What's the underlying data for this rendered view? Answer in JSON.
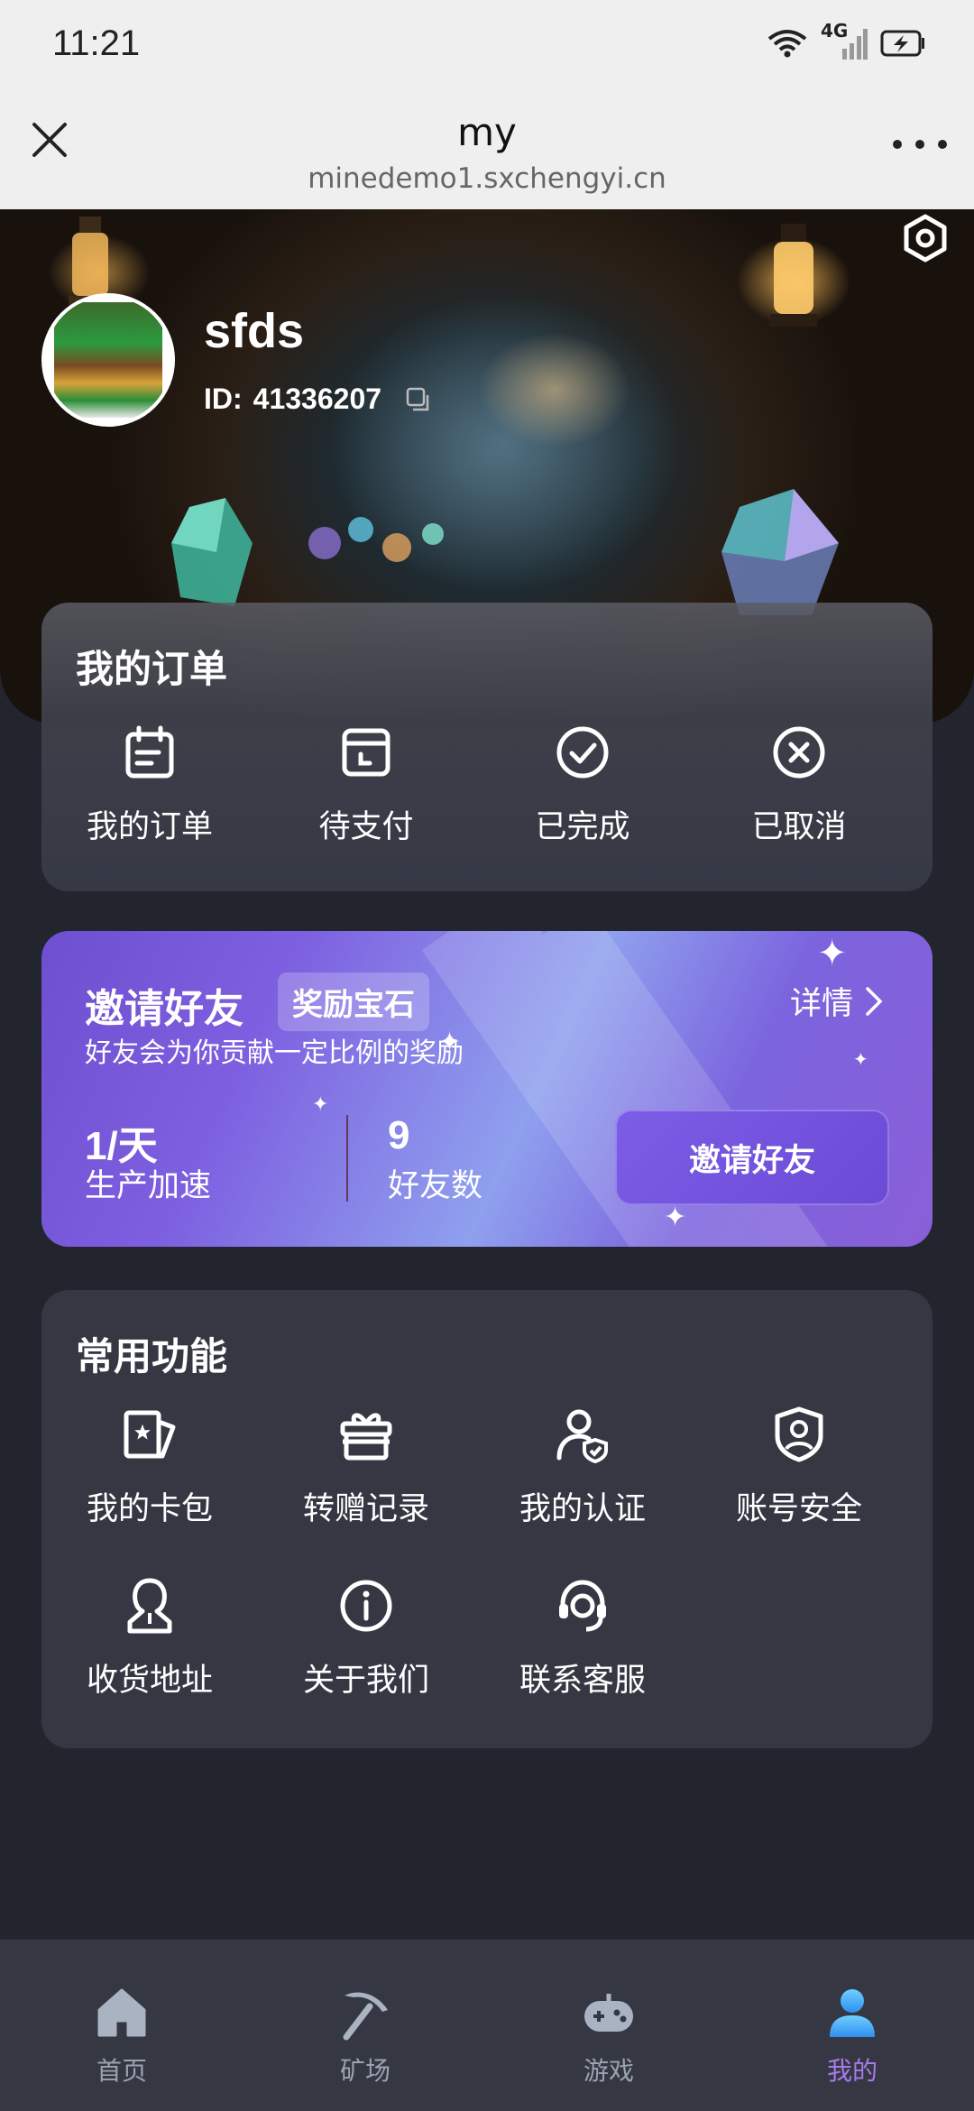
{
  "status_bar": {
    "time": "11:21",
    "network": "4G"
  },
  "browser": {
    "title": "my",
    "url": "minedemo1.sxchengyi.cn"
  },
  "profile": {
    "username": "sfds",
    "id_label": "ID:",
    "id_value": "41336207"
  },
  "orders": {
    "title": "我的订单",
    "items": [
      {
        "label": "我的订单",
        "icon": "calendar-icon"
      },
      {
        "label": "待支付",
        "icon": "wallet-icon"
      },
      {
        "label": "已完成",
        "icon": "check-circle-icon"
      },
      {
        "label": "已取消",
        "icon": "x-circle-icon"
      }
    ]
  },
  "invite": {
    "title": "邀请好友",
    "badge": "奖励宝石",
    "detail": "详情",
    "description": "好友会为你贡献一定比例的奖励",
    "speed_value": "1/天",
    "speed_label": "生产加速",
    "friends_value": "9",
    "friends_label": "好友数",
    "button": "邀请好友"
  },
  "features": {
    "title": "常用功能",
    "items": [
      {
        "label": "我的卡包",
        "icon": "card-icon"
      },
      {
        "label": "转赠记录",
        "icon": "gift-icon"
      },
      {
        "label": "我的认证",
        "icon": "user-verify-icon"
      },
      {
        "label": "账号安全",
        "icon": "shield-user-icon"
      },
      {
        "label": "收货地址",
        "icon": "person-location-icon"
      },
      {
        "label": "关于我们",
        "icon": "info-icon"
      },
      {
        "label": "联系客服",
        "icon": "headset-icon"
      }
    ]
  },
  "bottom_nav": {
    "items": [
      {
        "label": "首页",
        "icon": "home-icon"
      },
      {
        "label": "矿场",
        "icon": "pickaxe-icon"
      },
      {
        "label": "游戏",
        "icon": "gamepad-icon"
      },
      {
        "label": "我的",
        "icon": "user-icon",
        "active": true
      }
    ]
  },
  "colors": {
    "background": "#22242e",
    "card": "#353843",
    "accent": "#a77ae8",
    "inactive": "#9aa3b0"
  }
}
